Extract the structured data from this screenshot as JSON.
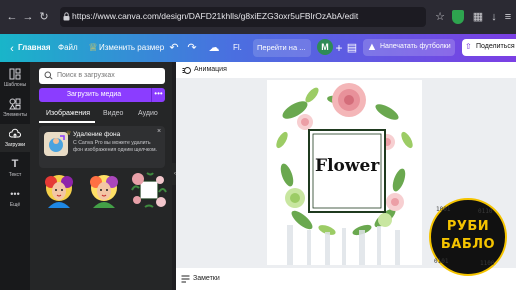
{
  "browser": {
    "url": "https://www.canva.com/design/DAFD21khlls/g8xiEZG3oxr5uFBlrOzAbA/edit"
  },
  "topbar": {
    "home_label": "Главная",
    "file_label": "Файл",
    "resize_label": "Изменить размер",
    "tab_short": "Fl.",
    "goto_label": "Перейти на ...",
    "avatar_letter": "M",
    "print_label": "Напечатать футболки",
    "share_label": "Поделиться"
  },
  "rail": {
    "items": [
      {
        "label": "Шаблоны",
        "icon": "templates-icon"
      },
      {
        "label": "Элементы",
        "icon": "elements-icon"
      },
      {
        "label": "Загрузки",
        "icon": "uploads-icon"
      },
      {
        "label": "Текст",
        "icon": "text-icon"
      },
      {
        "label": "Ещё",
        "icon": "more-icon"
      }
    ]
  },
  "panel": {
    "search_placeholder": "Поиск в загрузках",
    "upload_label": "Загрузить медиа",
    "upload_more": "•••",
    "tabs": [
      "Изображения",
      "Видео",
      "Аудио"
    ],
    "promo": {
      "title": "Удаление фона",
      "text": "С Canva Pro вы можете удалить фон изображения одним щелчком.",
      "close": "×"
    }
  },
  "canvas": {
    "animation_label": "Анимация",
    "notes_label": "Заметки",
    "design_text": "Flower"
  },
  "watermark": {
    "line1": "РУБИ",
    "line2": "БАБЛО"
  },
  "colors": {
    "brand_purple": "#8b3dff",
    "topbar_start": "#19b5c9",
    "topbar_end": "#7b3fe4"
  }
}
